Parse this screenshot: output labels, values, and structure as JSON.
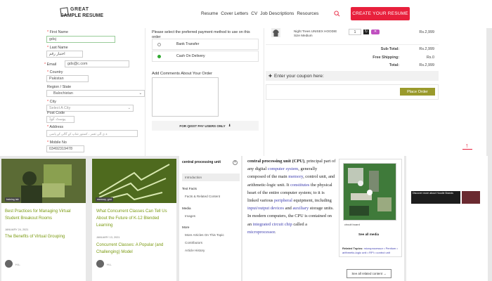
{
  "header": {
    "logo_line1": "GREAT",
    "logo_line2": "SAMPLE RESUME",
    "nav": [
      "Resume",
      "Cover Letters",
      "CV",
      "Job Descriptions",
      "Resources"
    ],
    "cta": "CREATE YOUR RESUME"
  },
  "form": {
    "first_name_label": "First Name",
    "first_name_value": "gdsj",
    "last_name_label": "Last Name",
    "last_name_value": "اختبار رقم",
    "email_label": "Email",
    "email_value": "gds@c.com",
    "country_label": "Country",
    "country_value": "Pakistan",
    "region_label": "Region / State",
    "region_value": "Balochistan",
    "city_label": "City",
    "city_value": "Select A City",
    "post_label": "Post Code",
    "post_value": "پوسٹ کوڈ",
    "address_label": "Address",
    "address_value": "ہ ی آلی تعمر ، کستور شاپ کے گالی کے پاسی",
    "mobile_label": "Mobile No",
    "mobile_value": "03492319478"
  },
  "payment": {
    "prompt": "Please select the preferred payment method to use on this order",
    "options": [
      "Bank Transfer",
      "Cash On Delivery"
    ],
    "comments_label": "Add Comments About Your Order",
    "promo": "FOR QISST PAY USERS ONLY"
  },
  "summary": {
    "item_name": "Night Trees UNISEX HOODIE",
    "item_size": "Size Medium",
    "item_qty": "1",
    "item_price": "Rs.2,999",
    "rows": [
      {
        "label": "Sub-Total:",
        "value": "Rs.2,999"
      },
      {
        "label": "Free Shipping:",
        "value": "Rs.0"
      },
      {
        "label": "Total:",
        "value": "Rs.2,999"
      }
    ],
    "coupon": "Enter your coupon here:",
    "place_order": "Place Order"
  },
  "cards": [
    {
      "tag": "training lab",
      "title": "Best Practices for Managing Virtual Student Breakout Rooms",
      "date": "JANUARY 24, 2021",
      "subtitle": "The Benefits of Virtual Grouping",
      "author": "H.L."
    },
    {
      "tag": "memory, grid",
      "title": "What Concurrent Classes Can Tell Us About the Future of K-12 Blended Learning",
      "date": "JANUARY 13, 2021",
      "subtitle": "Concurrent Classes: A Popular (and Challenging) Model",
      "author": "H.L."
    }
  ],
  "wiki": {
    "sidebar_title": "central processing unit",
    "sidebar_items": [
      "Introduction",
      "Text Facts",
      "Facts & Related Content",
      "Media",
      "Images",
      "More",
      "More Articles On This Topic",
      "Contributors",
      "Article History"
    ],
    "p1_bold": "central processing unit (CPU)",
    "p1_a": ", principal part of any digital ",
    "link_computer": "computer system",
    "p1_b": ", generally composed of the main ",
    "link_memory": "memory",
    "p1_c": ", control unit, and arithmetic-logic unit. It ",
    "link_constitutes": "constitutes",
    "p1_d": " the physical heart of the entire computer system; to it is linked various ",
    "link_peripheral": "peripheral",
    "p1_e": " equipment, including ",
    "link_io": "input/output devices",
    "p1_f": " and ",
    "link_aux": "auxiliary",
    "p1_g": " storage units. In modern computers, the CPU is contained on an ",
    "link_ic": "integrated circuit chip",
    "p1_h": " called a ",
    "link_micro": "microprocessor",
    "p1_i": ".",
    "img_caption": "circuit board",
    "see_media": "See all media",
    "related_label": "Related Topics:",
    "related_list": "microprocessor • Pentium • arithmetic-logic unit • RPI • control unit",
    "see_related": "See all related content →",
    "ad_text": "Discover more about Hoodie Brands"
  },
  "colors": {
    "cta": "#e8203c",
    "accent": "#7a9a10",
    "place_order": "#9a9a2c",
    "link": "#4040b0"
  }
}
